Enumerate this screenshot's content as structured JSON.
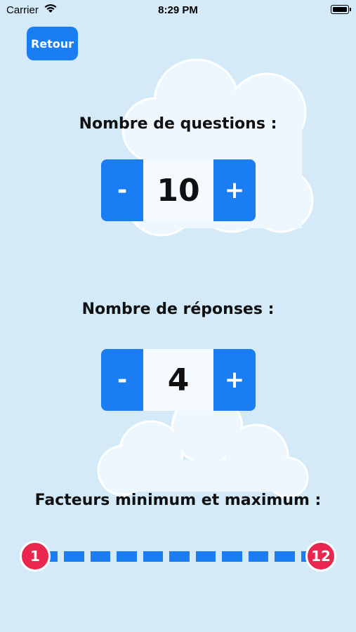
{
  "status_bar": {
    "carrier": "Carrier",
    "time": "8:29 PM"
  },
  "back_button": {
    "label": "Retour"
  },
  "questions": {
    "title": "Nombre de questions :",
    "minus": "-",
    "value": "10",
    "plus": "+"
  },
  "answers": {
    "title": "Nombre de réponses :",
    "minus": "-",
    "value": "4",
    "plus": "+"
  },
  "factors": {
    "title": "Facteurs minimum et maximum :",
    "min": "1",
    "max": "12"
  },
  "colors": {
    "background": "#d4eaf8",
    "accent": "#1a7ef2",
    "handle": "#e8264e"
  }
}
